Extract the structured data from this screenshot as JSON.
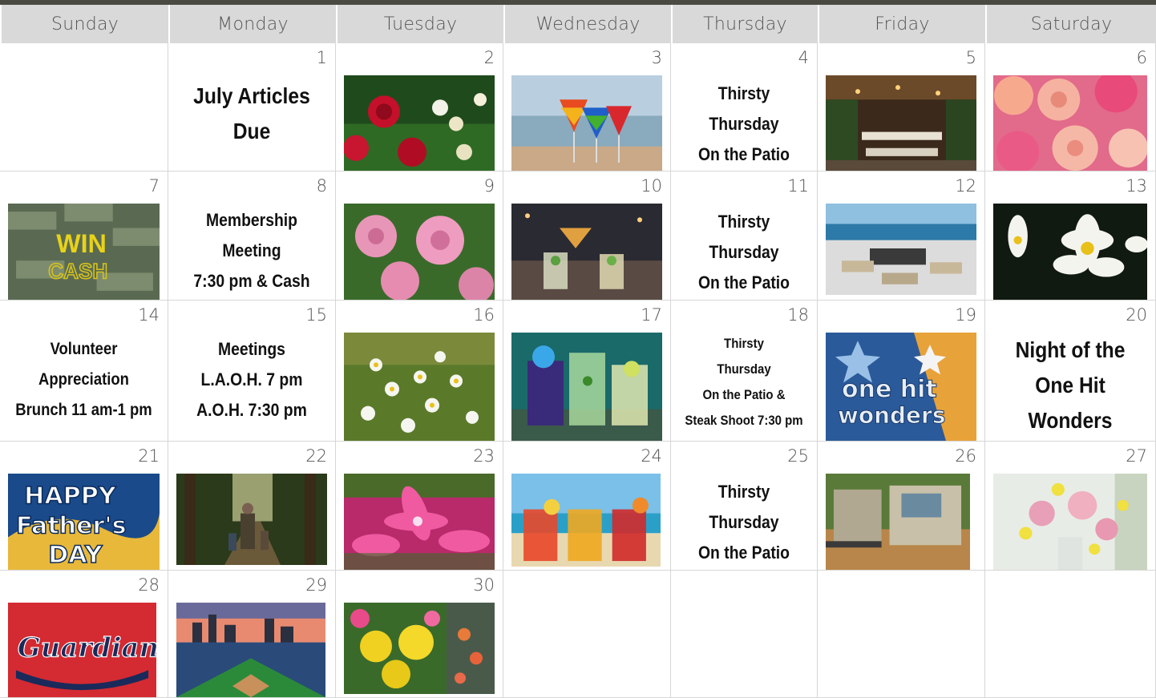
{
  "weekdays": [
    "Sunday",
    "Monday",
    "Tuesday",
    "Wednesday",
    "Thursday",
    "Friday",
    "Saturday"
  ],
  "days": {
    "d1": "1",
    "d2": "2",
    "d3": "3",
    "d4": "4",
    "d5": "5",
    "d6": "6",
    "d7": "7",
    "d8": "8",
    "d9": "9",
    "d10": "10",
    "d11": "11",
    "d12": "12",
    "d13": "13",
    "d14": "14",
    "d15": "15",
    "d16": "16",
    "d17": "17",
    "d18": "18",
    "d19": "19",
    "d20": "20",
    "d21": "21",
    "d22": "22",
    "d23": "23",
    "d24": "24",
    "d25": "25",
    "d26": "26",
    "d27": "27",
    "d28": "28",
    "d29": "29",
    "d30": "30"
  },
  "events": {
    "articles": [
      "July Articles",
      "Due"
    ],
    "thirsty": [
      "Thirsty",
      "Thursday",
      "On the Patio"
    ],
    "membership": [
      "Membership",
      "Meeting",
      "7:30 pm & Cash"
    ],
    "volunteer": [
      "Volunteer",
      "Appreciation",
      "Brunch 11 am-1 pm"
    ],
    "meetings": [
      "Meetings",
      "L.A.O.H. 7 pm",
      "A.O.H. 7:30 pm"
    ],
    "steak": [
      "Thirsty",
      "Thursday",
      "On the Patio &",
      "Steak Shoot 7:30 pm"
    ],
    "wonders": [
      "Night of the",
      "One Hit Wonders"
    ]
  },
  "image_text": {
    "win": "WIN",
    "cash": "CASH",
    "onehit1": "one hit",
    "onehit2": "wonders",
    "happy": "HAPPY",
    "fathers": "Father's",
    "day": "DAY",
    "guardians": "Guardians"
  },
  "colors": {
    "header_bg": "#d9d9d9",
    "top_bar": "#4a4a43",
    "grid_line": "#d6d6d6"
  }
}
